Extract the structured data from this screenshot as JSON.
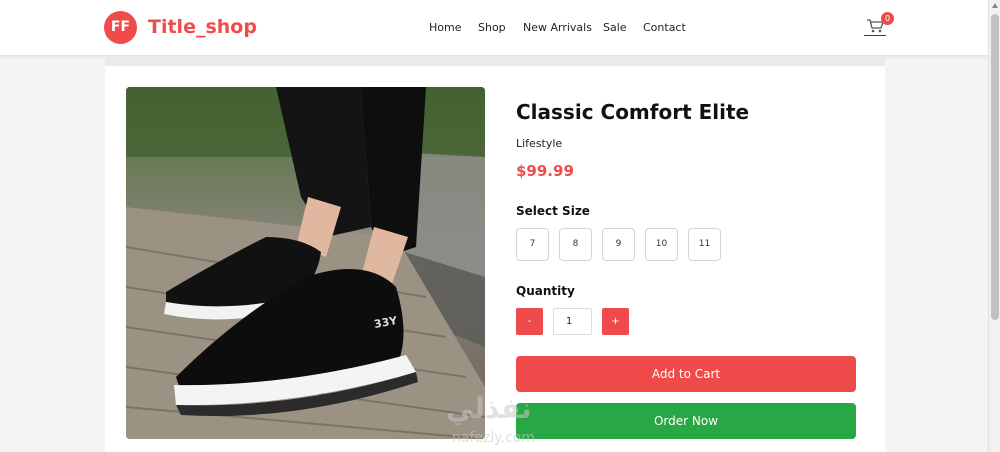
{
  "header": {
    "logo_initials": "FF",
    "shop_name": "Title_shop",
    "nav": [
      "Home",
      "Shop",
      "New Arrivals",
      "Sale",
      "Contact"
    ],
    "cart_count": "0"
  },
  "product": {
    "image_icon": "shoe-photo",
    "title": "Classic Comfort Elite",
    "category": "Lifestyle",
    "price": "$99.99",
    "shoe_tag": "33Y",
    "size_label": "Select Size",
    "sizes": [
      "7",
      "8",
      "9",
      "10",
      "11"
    ],
    "quantity_label": "Quantity",
    "minus_label": "-",
    "plus_label": "+",
    "quantity_value": "1",
    "add_to_cart_label": "Add to Cart",
    "order_now_label": "Order Now"
  },
  "watermark": {
    "arabic": "نفذلي",
    "latin": "nafezly.com"
  },
  "colors": {
    "accent": "#ef4b4b",
    "order_button": "#28a745"
  }
}
